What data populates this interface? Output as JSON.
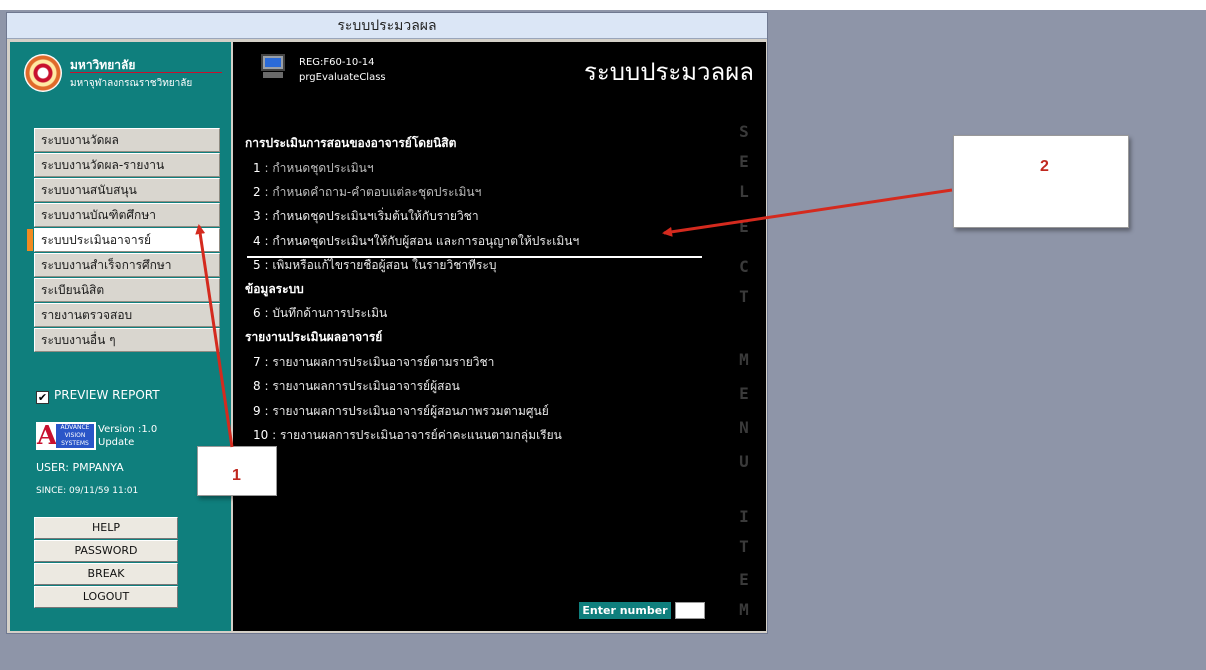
{
  "window": {
    "title": "ระบบประมวลผล"
  },
  "sidebar": {
    "university_name": "มหาวิทยาลัย",
    "university_sub": "มหาจุฬาลงกรณราชวิทยาลัย",
    "menu": [
      {
        "label": "ระบบงานวัดผล"
      },
      {
        "label": "ระบบงานวัดผล-รายงาน"
      },
      {
        "label": "ระบบงานสนับสนุน"
      },
      {
        "label": "ระบบงานบัณฑิตศึกษา"
      },
      {
        "label": "ระบบประเมินอาจารย์"
      },
      {
        "label": "ระบบงานสำเร็จการศึกษา"
      },
      {
        "label": "ระเบียนนิสิต"
      },
      {
        "label": "รายงานตรวจสอบ"
      },
      {
        "label": "ระบบงานอื่น ๆ"
      }
    ],
    "active_index": 4,
    "preview_label": "PREVIEW REPORT",
    "preview_checked": true,
    "vendor_logo_lines": [
      "ADVANCE",
      "VISION",
      "SYSTEMS"
    ],
    "version_text": "Version :1.0",
    "update_text": "Update",
    "user_text": "USER: PMPANYA",
    "since_text": "SINCE: 09/11/59 11:01",
    "buttons": [
      "HELP",
      "PASSWORD",
      "BREAK",
      "LOGOUT"
    ]
  },
  "main": {
    "program_code": "REG:F60-10-14",
    "program_name": "prgEvaluateClass",
    "header_title": "ระบบประมวลผล",
    "sections": [
      {
        "heading": "การประเมินการสอนของอาจารย์โดยนิสิต"
      },
      {
        "heading": "ข้อมูลระบบ"
      },
      {
        "heading": "รายงานประเมินผลอาจารย์"
      }
    ],
    "items": [
      {
        "num": "1",
        "label": "กำหนดชุดประเมินฯ"
      },
      {
        "num": "2",
        "label": "กำหนดคำถาม-คำตอบแต่ละชุดประเมินฯ"
      },
      {
        "num": "3",
        "label": "กำหนดชุดประเมินฯเริ่มต้นให้กับรายวิชา"
      },
      {
        "num": "4",
        "label": "กำหนดชุดประเมินฯให้กับผู้สอน และการอนุญาตให้ประเมินฯ"
      },
      {
        "num": "5",
        "label": "เพิ่มหรือแก้ไขรายชื่อผู้สอน ในรายวิชาที่ระบุ"
      },
      {
        "num": "6",
        "label": "บันทึกด้านการประเมิน"
      },
      {
        "num": "7",
        "label": "รายงานผลการประเมินอาจารย์ตามรายวิชา"
      },
      {
        "num": "8",
        "label": "รายงานผลการประเมินอาจารย์ผู้สอน"
      },
      {
        "num": "9",
        "label": "รายงานผลการประเมินอาจารย์ผู้สอนภาพรวมตามศูนย์"
      },
      {
        "num": "10",
        "label": "รายงานผลการประเมินอาจารย์ค่าคะแนนตามกลุ่มเรียน"
      }
    ],
    "side_letters": [
      "S",
      "E",
      "L",
      "E",
      "C",
      "T",
      "M",
      "E",
      "N",
      "U",
      "I",
      "T",
      "E",
      "M"
    ],
    "enter_label": "Enter number",
    "enter_value": ""
  },
  "annotations": {
    "callout_1": "1",
    "callout_2": "2",
    "arrow_color": "#d42a1e"
  }
}
